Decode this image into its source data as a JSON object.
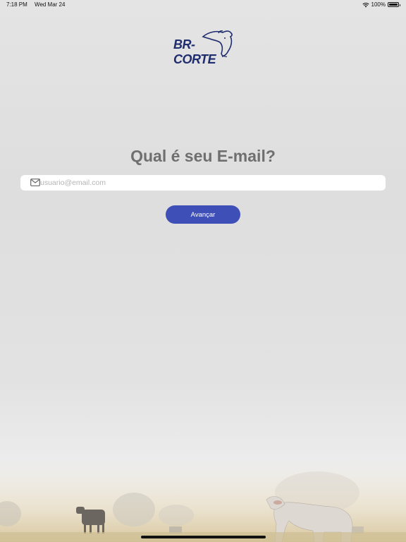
{
  "status_bar": {
    "time": "7:18 PM",
    "date": "Wed Mar 24",
    "battery_text": "100%",
    "battery_level": 1.0,
    "wifi_icon": "wifi-icon",
    "battery_icon": "battery-icon"
  },
  "brand": {
    "logo_text": "BR-CORTE",
    "logo_color": "#1f2c6e"
  },
  "page": {
    "title": "Qual é seu E-mail?"
  },
  "email": {
    "value": "",
    "placeholder": "usuario@email.com",
    "icon": "mail-icon"
  },
  "actions": {
    "advance_label": "Avançar",
    "accent_color": "#3f4fb8"
  }
}
